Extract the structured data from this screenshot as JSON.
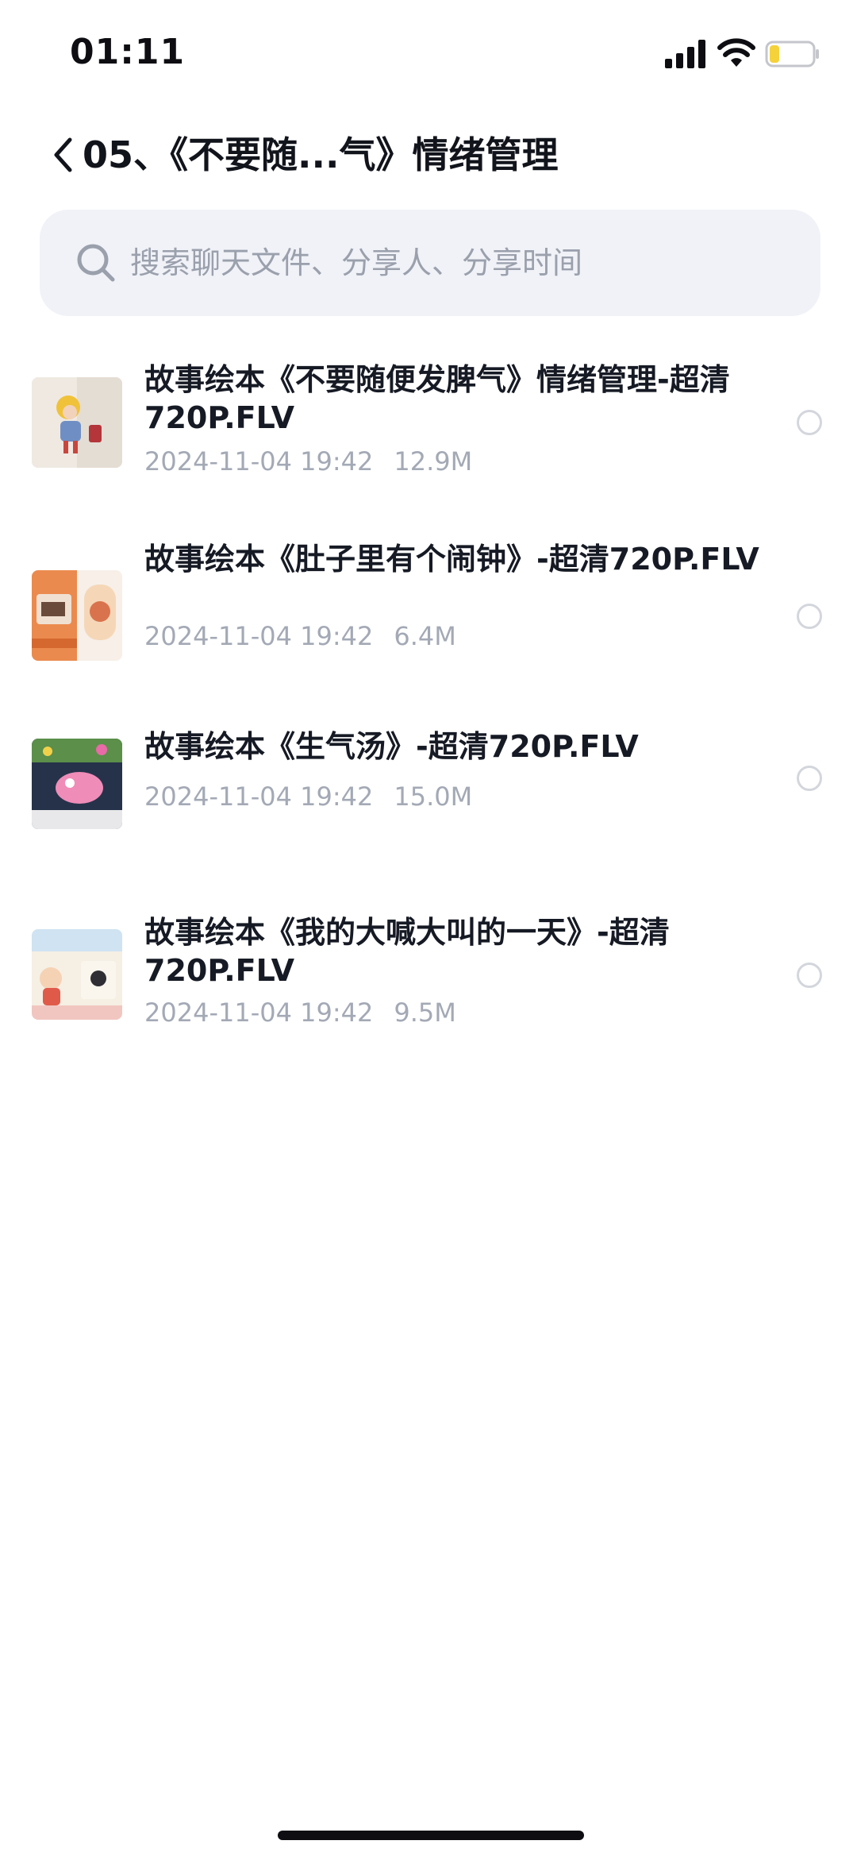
{
  "status_bar": {
    "time": "01:11",
    "icons": [
      "signal-icon",
      "wifi-icon",
      "battery-icon"
    ],
    "battery_color": "#f5d23a"
  },
  "header": {
    "back_icon": "chevron-left-icon",
    "title": "05、《不要随...气》情绪管理"
  },
  "search": {
    "icon": "search-icon",
    "placeholder": "搜索聊天文件、分享人、分享时间"
  },
  "files": [
    {
      "name": "故事绘本《不要随便发脾气》情绪管理-超清720P.FLV",
      "date": "2024-11-04 19:42",
      "size": "12.9M"
    },
    {
      "name": "故事绘本《肚子里有个闹钟》-超清720P.FLV",
      "date": "2024-11-04 19:42",
      "size": "6.4M"
    },
    {
      "name": "故事绘本《生气汤》-超清720P.FLV",
      "date": "2024-11-04 19:42",
      "size": "15.0M"
    },
    {
      "name": "故事绘本《我的大喊大叫的一天》-超清720P.FLV",
      "date": "2024-11-04 19:42",
      "size": "9.5M"
    }
  ]
}
